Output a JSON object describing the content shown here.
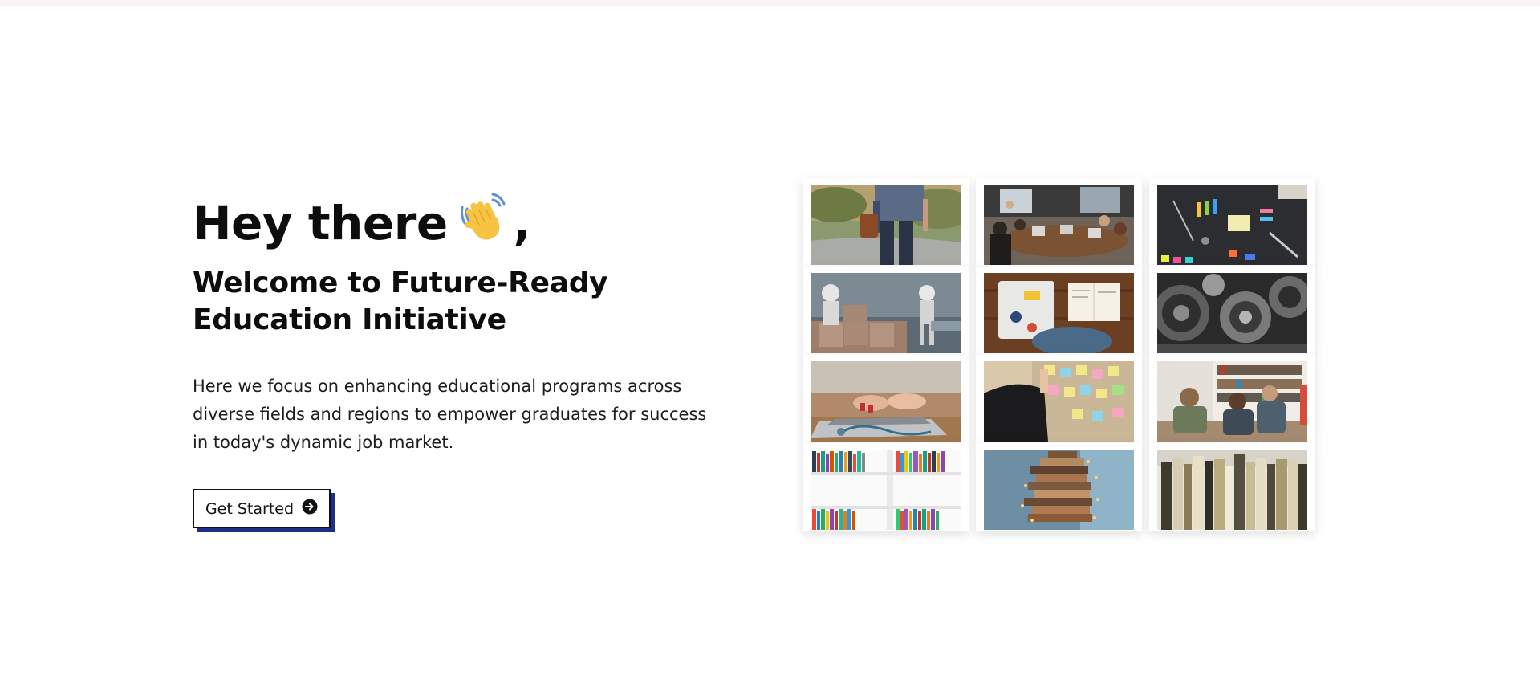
{
  "hero": {
    "greeting_text": "Hey there",
    "greeting_suffix": ",",
    "wave_icon": "waving-hand-icon",
    "welcome_heading": "Welcome to Future-Ready Education Initiative",
    "description": "Here we focus on enhancing educational programs across diverse fields and regions to empower graduates for success in today's dynamic job market.",
    "cta_label": "Get Started",
    "cta_icon": "arrow-circle-right-icon"
  },
  "gallery": {
    "images": [
      {
        "name": "walking-person-with-bag-photo"
      },
      {
        "name": "meeting-room-laptops-photo"
      },
      {
        "name": "craft-tools-flatlay-photo"
      },
      {
        "name": "robot-toys-blocks-photo"
      },
      {
        "name": "laptop-stickers-notebook-photo"
      },
      {
        "name": "mechanical-gears-photo"
      },
      {
        "name": "typing-laptop-stethoscope-photo"
      },
      {
        "name": "sticky-notes-board-photo"
      },
      {
        "name": "people-bookshelf-discussion-photo"
      },
      {
        "name": "colorful-bookshelf-photo"
      },
      {
        "name": "book-tower-lights-photo"
      },
      {
        "name": "old-books-row-photo"
      }
    ]
  },
  "colors": {
    "accent_shadow": "#1e2f8a",
    "text_dark": "#0d0d0d",
    "top_bar": "#fdf3f6"
  }
}
